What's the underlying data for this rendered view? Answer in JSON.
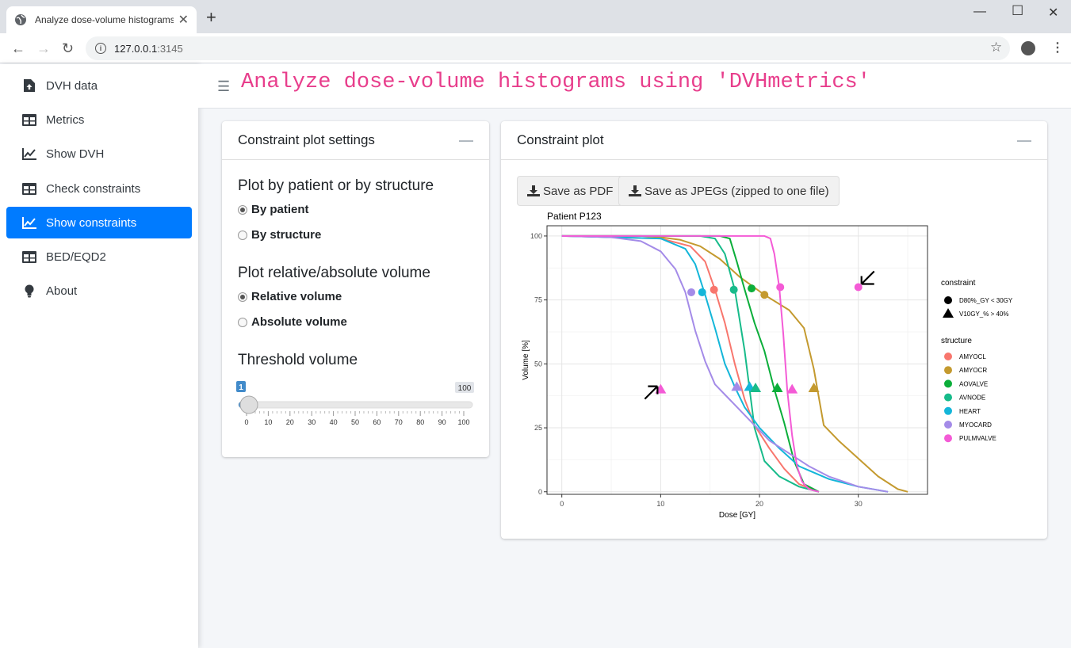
{
  "browser": {
    "tab_title": "Analyze dose-volume histograms",
    "url_host": "127.0.0.1",
    "url_port": ":3145"
  },
  "sidebar": {
    "items": [
      {
        "label": "DVH data",
        "icon": "file-upload-icon"
      },
      {
        "label": "Metrics",
        "icon": "table-icon"
      },
      {
        "label": "Show DVH",
        "icon": "line-chart-icon"
      },
      {
        "label": "Check constraints",
        "icon": "table-icon"
      },
      {
        "label": "Show constraints",
        "icon": "line-chart-icon",
        "active": true
      },
      {
        "label": "BED/EQD2",
        "icon": "table-icon"
      },
      {
        "label": "About",
        "icon": "lightbulb-icon"
      }
    ]
  },
  "header": {
    "title": "Analyze dose-volume histograms using 'DVHmetrics'"
  },
  "settings_card": {
    "title": "Constraint plot settings",
    "plot_by_label": "Plot by patient or by structure",
    "plot_by_options": [
      "By patient",
      "By structure"
    ],
    "plot_by_selected": "By patient",
    "volume_label": "Plot relative/absolute volume",
    "volume_options": [
      "Relative volume",
      "Absolute volume"
    ],
    "volume_selected": "Relative volume",
    "threshold_label": "Threshold volume",
    "slider": {
      "value": 1,
      "max_label": "100",
      "min": 0,
      "max": 100,
      "ticks": [
        "0",
        "10",
        "20",
        "30",
        "40",
        "50",
        "60",
        "70",
        "80",
        "90",
        "100"
      ]
    }
  },
  "plot_card": {
    "title": "Constraint plot",
    "save_pdf": "Save as PDF",
    "save_jpeg": "Save as JPEGs (zipped to one file)"
  },
  "colors": {
    "accent": "#007bff",
    "title": "#e83e8c",
    "AMYOCL": "#F8766D",
    "AMYOCR": "#C49A2F",
    "AOVALVE": "#0BAE3A",
    "AVNODE": "#17BB8A",
    "HEART": "#14B6D9",
    "MYOCARD": "#A48BE8",
    "PULMVALVE": "#F45BD6"
  },
  "chart_data": {
    "type": "line",
    "title": "Patient P123",
    "xlabel": "Dose [GY]",
    "ylabel": "Volume [%]",
    "xlim": [
      -1.5,
      37
    ],
    "ylim": [
      -1,
      104
    ],
    "x_ticks": [
      0,
      10,
      20,
      30
    ],
    "y_ticks": [
      0,
      25,
      50,
      75,
      100
    ],
    "grid": true,
    "legend_constraint_title": "constraint",
    "legend_constraint": [
      {
        "label": "D80%_GY < 30GY",
        "shape": "circle"
      },
      {
        "label": "V10GY_% > 40%",
        "shape": "triangle"
      }
    ],
    "legend_structure_title": "structure",
    "series": [
      {
        "name": "AMYOCL",
        "x": [
          0,
          10,
          13,
          14.5,
          15.5,
          16.5,
          17.5,
          18.5,
          19.5,
          21,
          22.5,
          24,
          26
        ],
        "y": [
          100,
          99,
          96,
          90,
          79,
          66,
          50,
          36,
          26,
          17,
          9,
          3,
          0
        ]
      },
      {
        "name": "AMYOCR",
        "x": [
          0,
          8,
          10,
          12,
          14,
          16,
          18,
          20.5,
          23,
          24.5,
          25.5,
          26.5,
          28,
          30,
          32,
          34,
          35
        ],
        "y": [
          100,
          100,
          99.5,
          98.5,
          96,
          91,
          84,
          77,
          71,
          64,
          48,
          26,
          20,
          13,
          6,
          1,
          0
        ]
      },
      {
        "name": "AOVALVE",
        "x": [
          0,
          16,
          17,
          17.7,
          18.5,
          19.5,
          20.5,
          21.5,
          22.5,
          23.5,
          24.5,
          26
        ],
        "y": [
          100,
          100,
          99,
          90,
          79,
          66,
          55,
          40,
          27,
          12,
          3,
          0
        ]
      },
      {
        "name": "AVNODE",
        "x": [
          0,
          14,
          15.5,
          16.5,
          17.5,
          18.5,
          19.5,
          20.5,
          22,
          24,
          26
        ],
        "y": [
          100,
          100,
          99,
          93,
          79,
          55,
          25,
          12,
          6,
          2,
          0
        ]
      },
      {
        "name": "HEART",
        "x": [
          0,
          10,
          12.5,
          13.5,
          14.5,
          15.5,
          16.5,
          17.5,
          18.5,
          20,
          22,
          24,
          27,
          30,
          33
        ],
        "y": [
          100,
          99,
          95,
          89,
          77,
          64,
          50,
          41,
          33,
          25,
          17,
          10,
          5,
          2,
          0
        ]
      },
      {
        "name": "MYOCARD",
        "x": [
          0,
          5,
          8,
          10,
          11.5,
          12.5,
          13.5,
          14.5,
          15.5,
          17,
          19,
          21,
          23,
          25,
          27,
          30,
          33
        ],
        "y": [
          100,
          99.5,
          98,
          94,
          87,
          78,
          63,
          51,
          42,
          36,
          28,
          20,
          15,
          10,
          6,
          2,
          0
        ]
      },
      {
        "name": "PULMVALVE",
        "x": [
          0,
          20.5,
          21.1,
          21.5,
          22,
          22.4,
          22.8,
          23.3,
          23.8,
          24.3,
          25,
          26
        ],
        "y": [
          100,
          100,
          99,
          93,
          80,
          62,
          40,
          22,
          10,
          4,
          1,
          0
        ]
      }
    ],
    "d80_points": [
      {
        "series": "AMYOCL",
        "x": 15.4,
        "y": 79
      },
      {
        "series": "AMYOCR",
        "x": 20.5,
        "y": 77
      },
      {
        "series": "AOVALVE",
        "x": 19.2,
        "y": 79.5
      },
      {
        "series": "AVNODE",
        "x": 17.4,
        "y": 79
      },
      {
        "series": "HEART",
        "x": 14.2,
        "y": 78
      },
      {
        "series": "MYOCARD",
        "x": 13.1,
        "y": 78
      },
      {
        "series": "PULMVALVE",
        "x": 22.1,
        "y": 80
      },
      {
        "series": "PULMVALVE",
        "x": 30,
        "y": 80
      }
    ],
    "v10_points": [
      {
        "series": "PULMVALVE",
        "x": 10,
        "y": 40
      },
      {
        "series": "MYOCARD",
        "x": 17.7,
        "y": 41
      },
      {
        "series": "HEART",
        "x": 19,
        "y": 41
      },
      {
        "series": "AVNODE",
        "x": 19.6,
        "y": 40.5
      },
      {
        "series": "AOVALVE",
        "x": 21.8,
        "y": 40.5
      },
      {
        "series": "PULMVALVE",
        "x": 23.3,
        "y": 40
      },
      {
        "series": "AMYOCR",
        "x": 25.5,
        "y": 40.5
      }
    ],
    "arrows": [
      {
        "series": "PULMVALVE",
        "x": 30,
        "y": 80,
        "direction": "down-left"
      },
      {
        "series": "PULMVALVE",
        "x": 10,
        "y": 40,
        "direction": "up-right"
      }
    ]
  }
}
